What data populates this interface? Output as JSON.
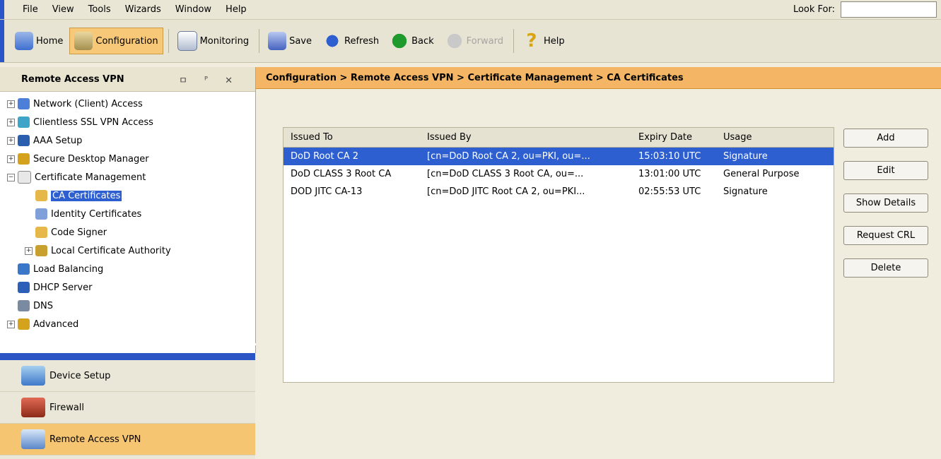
{
  "menu": {
    "items": [
      "File",
      "View",
      "Tools",
      "Wizards",
      "Window",
      "Help"
    ],
    "look_for_label": "Look For:"
  },
  "toolbar": {
    "home": "Home",
    "configuration": "Configuration",
    "monitoring": "Monitoring",
    "save": "Save",
    "refresh": "Refresh",
    "back": "Back",
    "forward": "Forward",
    "help": "Help"
  },
  "left_panel": {
    "title": "Remote Access VPN",
    "header_buttons": "ㅁ ᴾ ✕",
    "tree": [
      "Network (Client) Access",
      "Clientless SSL VPN Access",
      "AAA Setup",
      "Secure Desktop Manager",
      "Certificate Management",
      "CA Certificates",
      "Identity Certificates",
      "Code Signer",
      "Local Certificate Authority",
      "Load Balancing",
      "DHCP Server",
      "DNS",
      "Advanced"
    ]
  },
  "nav_buttons": [
    "Device Setup",
    "Firewall",
    "Remote Access VPN"
  ],
  "breadcrumb": "Configuration > Remote Access VPN > Certificate Management > CA Certificates",
  "table": {
    "headers": [
      "Issued To",
      "Issued By",
      "Expiry Date",
      "Usage"
    ],
    "rows": [
      [
        "DoD Root CA 2",
        "[cn=DoD Root CA 2, ou=PKI, ou=...",
        "15:03:10 UTC",
        "Signature"
      ],
      [
        "DoD CLASS 3 Root CA",
        "[cn=DoD CLASS 3 Root CA, ou=...",
        "13:01:00 UTC",
        "General Purpose"
      ],
      [
        "DOD JITC CA-13",
        "[cn=DoD JITC Root CA 2, ou=PKI...",
        "02:55:53 UTC",
        "Signature"
      ]
    ]
  },
  "buttons": [
    "Add",
    "Edit",
    "Show Details",
    "Request CRL",
    "Delete"
  ],
  "colors": {
    "accent_orange": "#f4b664",
    "selection_blue": "#2d5fd0",
    "background": "#f0ecde"
  }
}
